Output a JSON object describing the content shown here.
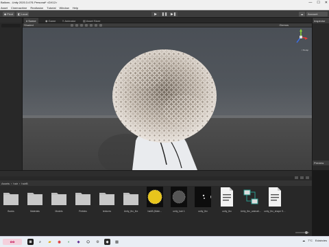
{
  "window": {
    "title": "Ballons - Unity 2020.3.47f1 Personal* <DX12>",
    "controls": [
      "—",
      "☐",
      "✕"
    ]
  },
  "menu": [
    "Asset",
    "Cinemachine",
    "Realtusion",
    "Tutorial",
    "Window",
    "Help"
  ],
  "toolbar": {
    "pivot": "Pivot",
    "local": "Local",
    "play_icons": [
      "▶",
      "❚❚",
      "▶❚"
    ],
    "account": "Account"
  },
  "scene_tabs": [
    {
      "label": "Scene",
      "active": true
    },
    {
      "label": "Game",
      "active": false
    },
    {
      "label": "Animator",
      "active": false
    },
    {
      "label": "Asset Store",
      "active": false
    }
  ],
  "scene_toolbar": {
    "shading_mode": "Shaded",
    "gizmos": "Gizmos"
  },
  "gizmo": {
    "projection": "< Persp"
  },
  "right_panel": {
    "inspector_tab": "Inspector",
    "preview_tab": "Preview"
  },
  "project": {
    "breadcrumb": [
      "Assets",
      "hair",
      "hairB"
    ],
    "assets": [
      {
        "label": "Books",
        "kind": "folder"
      },
      {
        "label": "Materials",
        "kind": "folder"
      },
      {
        "label": "Models",
        "kind": "folder"
      },
      {
        "label": "Prefabs",
        "kind": "folder"
      },
      {
        "label": "textures",
        "kind": "folder"
      },
      {
        "label": "Unity_fbx_fbx",
        "kind": "folder"
      },
      {
        "label": "hairB (Mate…",
        "kind": "yellow-material"
      },
      {
        "label": "unity_hair 1",
        "kind": "dark-material"
      },
      {
        "label": "unity_fbx",
        "kind": "dark-small"
      },
      {
        "label": "unity_fbx",
        "kind": "doc"
      },
      {
        "label": "Unity_fbx_animati…",
        "kind": "anim-graph"
      },
      {
        "label": "unity_fbx_shape S…",
        "kind": "doc"
      }
    ]
  },
  "taskbar": {
    "weather": "7°C",
    "weather_desc": "Eclaircies"
  },
  "colors": {
    "editor_bg": "#191919",
    "panel": "#282828",
    "toolbar": "#3c3c3c",
    "accent_yellow": "#e8c51c",
    "gizmo_x": "#e23b3b",
    "gizmo_y": "#8ad23b",
    "gizmo_z": "#3b6ee2"
  }
}
